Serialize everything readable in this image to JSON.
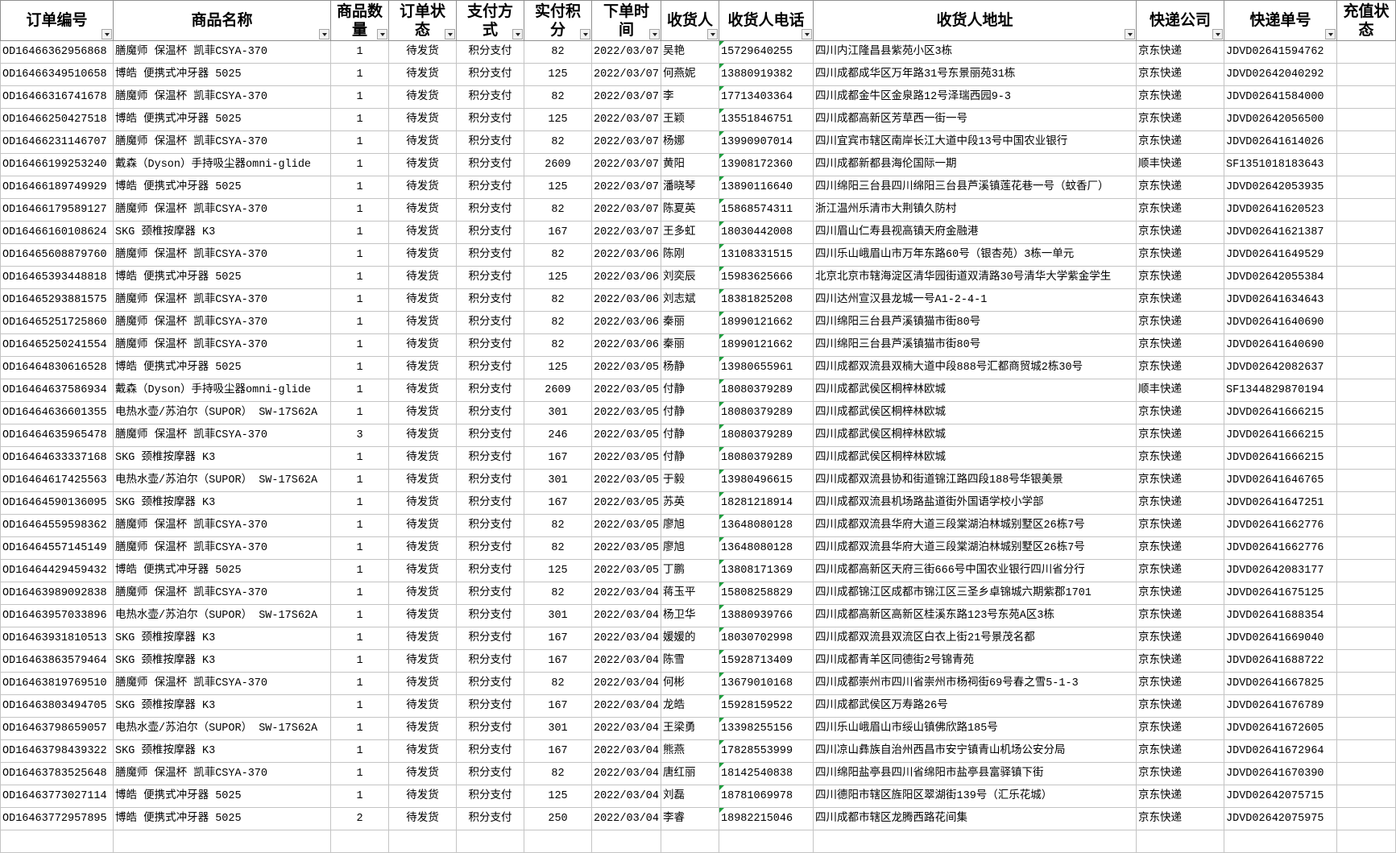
{
  "table": {
    "columns": [
      "订单编号",
      "商品名称",
      "商品数量",
      "订单状态",
      "支付方式",
      "实付积分",
      "下单时间",
      "收货人",
      "收货人电话",
      "收货人地址",
      "快递公司",
      "快递单号",
      "充值状态"
    ],
    "rows": [
      [
        "OD16466362956868",
        "膳魔师 保温杯 凯菲CSYA-370",
        "1",
        "待发货",
        "积分支付",
        "82",
        "2022/03/07",
        "吴艳",
        "15729640255",
        "四川内江隆昌县紫苑小区3栋",
        "京东快递",
        "JDVD02641594762"
      ],
      [
        "OD16466349510658",
        "博皓 便携式冲牙器 5025",
        "1",
        "待发货",
        "积分支付",
        "125",
        "2022/03/07",
        "何燕妮",
        "13880919382",
        "四川成都成华区万年路31号东景丽苑31栋",
        "京东快递",
        "JDVD02642040292"
      ],
      [
        "OD16466316741678",
        "膳魔师 保温杯 凯菲CSYA-370",
        "1",
        "待发货",
        "积分支付",
        "82",
        "2022/03/07",
        "李",
        "17713403364",
        "四川成都金牛区金泉路12号泽瑞西园9-3",
        "京东快递",
        "JDVD02641584000"
      ],
      [
        "OD16466250427518",
        "博皓 便携式冲牙器 5025",
        "1",
        "待发货",
        "积分支付",
        "125",
        "2022/03/07",
        "王颖",
        "13551846751",
        "四川成都高新区芳草西一街一号",
        "京东快递",
        "JDVD02642056500"
      ],
      [
        "OD16466231146707",
        "膳魔师 保温杯 凯菲CSYA-370",
        "1",
        "待发货",
        "积分支付",
        "82",
        "2022/03/07",
        "杨娜",
        "13990907014",
        "四川宜宾市辖区南岸长江大道中段13号中国农业银行",
        "京东快递",
        "JDVD02641614026"
      ],
      [
        "OD16466199253240",
        "戴森（Dyson）手持吸尘器omni-glide",
        "1",
        "待发货",
        "积分支付",
        "2609",
        "2022/03/07",
        "黄阳",
        "13908172360",
        "四川成都新都县海伦国际一期",
        "顺丰快递",
        "SF1351018183643"
      ],
      [
        "OD16466189749929",
        "博皓 便携式冲牙器 5025",
        "1",
        "待发货",
        "积分支付",
        "125",
        "2022/03/07",
        "潘晓琴",
        "13890116640",
        "四川绵阳三台县四川绵阳三台县芦溪镇莲花巷一号（蚊香厂）",
        "京东快递",
        "JDVD02642053935"
      ],
      [
        "OD16466179589127",
        "膳魔师 保温杯 凯菲CSYA-370",
        "1",
        "待发货",
        "积分支付",
        "82",
        "2022/03/07",
        "陈夏英",
        "15868574311",
        "浙江温州乐清市大荆镇久防村",
        "京东快递",
        "JDVD02641620523"
      ],
      [
        "OD16466160108624",
        "SKG 颈椎按摩器 K3",
        "1",
        "待发货",
        "积分支付",
        "167",
        "2022/03/07",
        "王多虹",
        "18030442008",
        "四川眉山仁寿县视高镇天府金融港",
        "京东快递",
        "JDVD02641621387"
      ],
      [
        "OD16465608879760",
        "膳魔师 保温杯 凯菲CSYA-370",
        "1",
        "待发货",
        "积分支付",
        "82",
        "2022/03/06",
        "陈刚",
        "13108331515",
        "四川乐山峨眉山市万年东路60号（银杏苑）3栋一单元",
        "京东快递",
        "JDVD02641649529"
      ],
      [
        "OD16465393448818",
        "博皓 便携式冲牙器 5025",
        "1",
        "待发货",
        "积分支付",
        "125",
        "2022/03/06",
        "刘奕辰",
        "15983625666",
        "北京北京市辖海淀区清华园街道双清路30号清华大学紫金学生",
        "京东快递",
        "JDVD02642055384"
      ],
      [
        "OD16465293881575",
        "膳魔师 保温杯 凯菲CSYA-370",
        "1",
        "待发货",
        "积分支付",
        "82",
        "2022/03/06",
        "刘志斌",
        "18381825208",
        "四川达州宣汉县龙城一号A1-2-4-1",
        "京东快递",
        "JDVD02641634643"
      ],
      [
        "OD16465251725860",
        "膳魔师 保温杯 凯菲CSYA-370",
        "1",
        "待发货",
        "积分支付",
        "82",
        "2022/03/06",
        "秦丽",
        "18990121662",
        "四川绵阳三台县芦溪镇猫市街80号",
        "京东快递",
        "JDVD02641640690"
      ],
      [
        "OD16465250241554",
        "膳魔师 保温杯 凯菲CSYA-370",
        "1",
        "待发货",
        "积分支付",
        "82",
        "2022/03/06",
        "秦丽",
        "18990121662",
        "四川绵阳三台县芦溪镇猫市街80号",
        "京东快递",
        "JDVD02641640690"
      ],
      [
        "OD16464830616528",
        "博皓 便携式冲牙器 5025",
        "1",
        "待发货",
        "积分支付",
        "125",
        "2022/03/05",
        "杨静",
        "13980655961",
        "四川成都双流县双楠大道中段888号汇都商贸城2栋30号",
        "京东快递",
        "JDVD02642082637"
      ],
      [
        "OD16464637586934",
        "戴森（Dyson）手持吸尘器omni-glide",
        "1",
        "待发货",
        "积分支付",
        "2609",
        "2022/03/05",
        "付静",
        "18080379289",
        "四川成都武侯区桐梓林欧城",
        "顺丰快递",
        "SF1344829870194"
      ],
      [
        "OD16464636601355",
        "电热水壶/苏泊尔（SUPOR） SW-17S62A",
        "1",
        "待发货",
        "积分支付",
        "301",
        "2022/03/05",
        "付静",
        "18080379289",
        "四川成都武侯区桐梓林欧城",
        "京东快递",
        "JDVD02641666215"
      ],
      [
        "OD16464635965478",
        "膳魔师 保温杯 凯菲CSYA-370",
        "3",
        "待发货",
        "积分支付",
        "246",
        "2022/03/05",
        "付静",
        "18080379289",
        "四川成都武侯区桐梓林欧城",
        "京东快递",
        "JDVD02641666215"
      ],
      [
        "OD16464633337168",
        "SKG 颈椎按摩器 K3",
        "1",
        "待发货",
        "积分支付",
        "167",
        "2022/03/05",
        "付静",
        "18080379289",
        "四川成都武侯区桐梓林欧城",
        "京东快递",
        "JDVD02641666215"
      ],
      [
        "OD16464617425563",
        "电热水壶/苏泊尔（SUPOR） SW-17S62A",
        "1",
        "待发货",
        "积分支付",
        "301",
        "2022/03/05",
        "于毅",
        "13980496615",
        "四川成都双流县协和街道锦江路四段188号华银美景",
        "京东快递",
        "JDVD02641646765"
      ],
      [
        "OD16464590136095",
        "SKG 颈椎按摩器 K3",
        "1",
        "待发货",
        "积分支付",
        "167",
        "2022/03/05",
        "苏英",
        "18281218914",
        "四川成都双流县机场路盐道街外国语学校小学部",
        "京东快递",
        "JDVD02641647251"
      ],
      [
        "OD16464559598362",
        "膳魔师 保温杯 凯菲CSYA-370",
        "1",
        "待发货",
        "积分支付",
        "82",
        "2022/03/05",
        "廖旭",
        "13648080128",
        "四川成都双流县华府大道三段棠湖泊林城别墅区26栋7号",
        "京东快递",
        "JDVD02641662776"
      ],
      [
        "OD16464557145149",
        "膳魔师 保温杯 凯菲CSYA-370",
        "1",
        "待发货",
        "积分支付",
        "82",
        "2022/03/05",
        "廖旭",
        "13648080128",
        "四川成都双流县华府大道三段棠湖泊林城别墅区26栋7号",
        "京东快递",
        "JDVD02641662776"
      ],
      [
        "OD16464429459432",
        "博皓 便携式冲牙器 5025",
        "1",
        "待发货",
        "积分支付",
        "125",
        "2022/03/05",
        "丁鹏",
        "13808171369",
        "四川成都高新区天府三街666号中国农业银行四川省分行",
        "京东快递",
        "JDVD02642083177"
      ],
      [
        "OD16463989092838",
        "膳魔师 保温杯 凯菲CSYA-370",
        "1",
        "待发货",
        "积分支付",
        "82",
        "2022/03/04",
        "蒋玉平",
        "15808258829",
        "四川成都锦江区成都市锦江区三圣乡卓锦城六期紫郡1701",
        "京东快递",
        "JDVD02641675125"
      ],
      [
        "OD16463957033896",
        "电热水壶/苏泊尔（SUPOR） SW-17S62A",
        "1",
        "待发货",
        "积分支付",
        "301",
        "2022/03/04",
        "杨卫华",
        "13880939766",
        "四川成都高新区高新区桂溪东路123号东苑A区3栋",
        "京东快递",
        "JDVD02641688354"
      ],
      [
        "OD16463931810513",
        "SKG 颈椎按摩器 K3",
        "1",
        "待发货",
        "积分支付",
        "167",
        "2022/03/04",
        "媛媛的",
        "18030702998",
        "四川成都双流县双流区白衣上街21号景茂名都",
        "京东快递",
        "JDVD02641669040"
      ],
      [
        "OD16463863579464",
        "SKG 颈椎按摩器 K3",
        "1",
        "待发货",
        "积分支付",
        "167",
        "2022/03/04",
        "陈雪",
        "15928713409",
        "四川成都青羊区同德街2号锦青苑",
        "京东快递",
        "JDVD02641688722"
      ],
      [
        "OD16463819769510",
        "膳魔师 保温杯 凯菲CSYA-370",
        "1",
        "待发货",
        "积分支付",
        "82",
        "2022/03/04",
        "何彬",
        "13679010168",
        "四川成都崇州市四川省崇州市杨祠街69号春之雪5-1-3",
        "京东快递",
        "JDVD02641667825"
      ],
      [
        "OD16463803494705",
        "SKG 颈椎按摩器 K3",
        "1",
        "待发货",
        "积分支付",
        "167",
        "2022/03/04",
        "龙皓",
        "15928159522",
        "四川成都武侯区万寿路26号",
        "京东快递",
        "JDVD02641676789"
      ],
      [
        "OD16463798659057",
        "电热水壶/苏泊尔（SUPOR） SW-17S62A",
        "1",
        "待发货",
        "积分支付",
        "301",
        "2022/03/04",
        "王梁勇",
        "13398255156",
        "四川乐山峨眉山市绥山镇佛欣路185号",
        "京东快递",
        "JDVD02641672605"
      ],
      [
        "OD16463798439322",
        "SKG 颈椎按摩器 K3",
        "1",
        "待发货",
        "积分支付",
        "167",
        "2022/03/04",
        "熊燕",
        "17828553999",
        "四川凉山彝族自治州西昌市安宁镇青山机场公安分局",
        "京东快递",
        "JDVD02641672964"
      ],
      [
        "OD16463783525648",
        "膳魔师 保温杯 凯菲CSYA-370",
        "1",
        "待发货",
        "积分支付",
        "82",
        "2022/03/04",
        "唐红丽",
        "18142540838",
        "四川绵阳盐亭县四川省绵阳市盐亭县富驿镇下街",
        "京东快递",
        "JDVD02641670390"
      ],
      [
        "OD16463773027114",
        "博皓 便携式冲牙器 5025",
        "1",
        "待发货",
        "积分支付",
        "125",
        "2022/03/04",
        "刘磊",
        "18781069978",
        "四川德阳市辖区旌阳区翠湖街139号（汇乐花城）",
        "京东快递",
        "JDVD02642075715"
      ],
      [
        "OD16463772957895",
        "博皓 便携式冲牙器 5025",
        "2",
        "待发货",
        "积分支付",
        "250",
        "2022/03/04",
        "李睿",
        "18982215046",
        "四川成都市辖区龙腾西路花间集",
        "京东快递",
        "JDVD02642075975"
      ]
    ]
  },
  "colors": {
    "number_as_text_flag": "#1e9e3e"
  }
}
